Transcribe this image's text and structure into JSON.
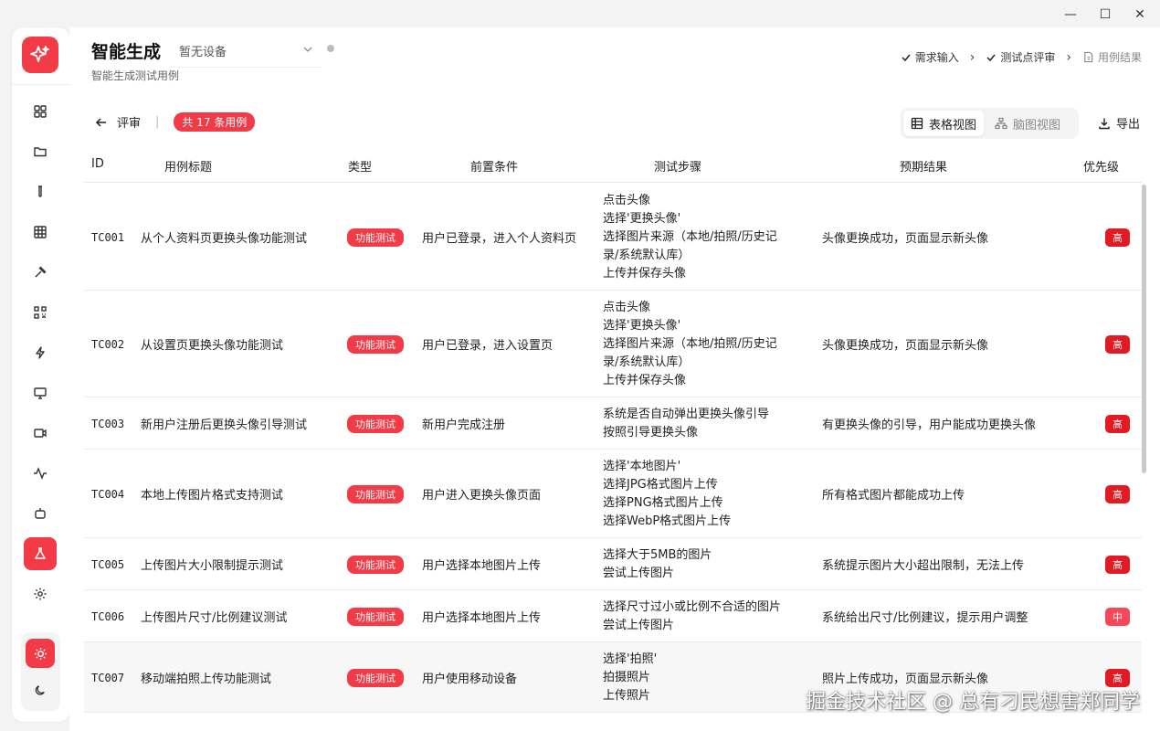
{
  "app": {
    "title": "智能生成",
    "subtitle": "智能生成测试用例",
    "device": "暂无设备"
  },
  "window_controls": {
    "minimize": "—",
    "maximize": "☐",
    "close": "✕"
  },
  "sidebar": {
    "items": [
      {
        "name": "dashboard-icon"
      },
      {
        "name": "folder-icon"
      },
      {
        "name": "test-tube-icon"
      },
      {
        "name": "grid-icon"
      },
      {
        "name": "hammer-icon"
      },
      {
        "name": "qrcode-icon"
      },
      {
        "name": "lightning-icon"
      },
      {
        "name": "monitor-icon"
      },
      {
        "name": "video-icon"
      },
      {
        "name": "activity-icon"
      },
      {
        "name": "robot-icon"
      },
      {
        "name": "flask-icon",
        "active": true
      },
      {
        "name": "settings-icon"
      }
    ],
    "theme": {
      "light": "sun-icon",
      "dark": "moon-icon"
    }
  },
  "steps": [
    {
      "label": "需求输入",
      "done": true
    },
    {
      "label": "测试点评审",
      "done": true
    },
    {
      "label": "用例结果",
      "done": false
    }
  ],
  "toolbar": {
    "back_label": "评审",
    "count_label": "共 17 条用例",
    "views": [
      {
        "label": "表格视图",
        "active": true
      },
      {
        "label": "脑图视图",
        "active": false
      }
    ],
    "export_label": "导出"
  },
  "table": {
    "headers": {
      "id": "ID",
      "title": "用例标题",
      "type": "类型",
      "pre": "前置条件",
      "steps": "测试步骤",
      "expected": "预期结果",
      "priority": "优先级"
    },
    "rows": [
      {
        "id": "TC001",
        "title": "从个人资料页更换头像功能测试",
        "type": "功能测试",
        "pre": "用户已登录，进入个人资料页",
        "steps": [
          "点击头像",
          "选择'更换头像'",
          "选择图片来源（本地/拍照/历史记",
          "录/系统默认库）",
          "上传并保存头像"
        ],
        "expected": "头像更换成功，页面显示新头像",
        "priority": "高"
      },
      {
        "id": "TC002",
        "title": "从设置页更换头像功能测试",
        "type": "功能测试",
        "pre": "用户已登录，进入设置页",
        "steps": [
          "点击头像",
          "选择'更换头像'",
          "选择图片来源（本地/拍照/历史记",
          "录/系统默认库）",
          "上传并保存头像"
        ],
        "expected": "头像更换成功，页面显示新头像",
        "priority": "高"
      },
      {
        "id": "TC003",
        "title": "新用户注册后更换头像引导测试",
        "type": "功能测试",
        "pre": "新用户完成注册",
        "steps": [
          "系统是否自动弹出更换头像引导",
          "按照引导更换头像"
        ],
        "expected": "有更换头像的引导，用户能成功更换头像",
        "priority": "高"
      },
      {
        "id": "TC004",
        "title": "本地上传图片格式支持测试",
        "type": "功能测试",
        "pre": "用户进入更换头像页面",
        "steps": [
          "选择'本地图片'",
          "选择JPG格式图片上传",
          "选择PNG格式图片上传",
          "选择WebP格式图片上传"
        ],
        "expected": "所有格式图片都能成功上传",
        "priority": "高"
      },
      {
        "id": "TC005",
        "title": "上传图片大小限制提示测试",
        "type": "功能测试",
        "pre": "用户选择本地图片上传",
        "steps": [
          "选择大于5MB的图片",
          "尝试上传图片"
        ],
        "expected": "系统提示图片大小超出限制，无法上传",
        "priority": "高"
      },
      {
        "id": "TC006",
        "title": "上传图片尺寸/比例建议测试",
        "type": "功能测试",
        "pre": "用户选择本地图片上传",
        "steps": [
          "选择尺寸过小或比例不合适的图片",
          "尝试上传图片"
        ],
        "expected": "系统给出尺寸/比例建议，提示用户调整",
        "priority": "中"
      },
      {
        "id": "TC007",
        "title": "移动端拍照上传功能测试",
        "type": "功能测试",
        "pre": "用户使用移动设备",
        "steps": [
          "选择'拍照'",
          "拍摄照片",
          "上传照片"
        ],
        "expected": "照片上传成功，页面显示新头像",
        "priority": "高"
      }
    ]
  },
  "watermark": "掘金技术社区 @ 总有刁民想害郑同学",
  "colors": {
    "accent": "#f23b46",
    "priority_high": "#e21b23",
    "priority_mid": "#f5495a"
  }
}
